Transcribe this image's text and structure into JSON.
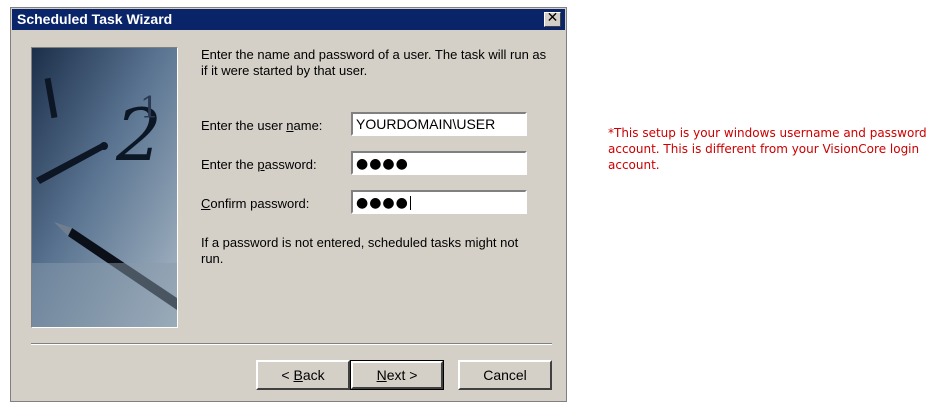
{
  "window": {
    "title": "Scheduled Task Wizard",
    "close_glyph": "✕"
  },
  "intro_text": "Enter the name and password of a user.  The task will run as if it were started by that user.",
  "fields": {
    "username": {
      "label_pre": "Enter the user ",
      "label_ul": "n",
      "label_post": "ame:",
      "value": "YOURDOMAIN\\USER"
    },
    "password": {
      "label_pre": "Enter the ",
      "label_ul": "p",
      "label_post": "assword:",
      "value": "●●●●"
    },
    "confirm": {
      "label_pre": "",
      "label_ul": "C",
      "label_post": "onfirm password:",
      "value": "●●●●"
    }
  },
  "warning_text": "If a password is not entered, scheduled tasks might not run.",
  "buttons": {
    "back": {
      "pre": "< ",
      "ul": "B",
      "post": "ack"
    },
    "next": {
      "pre": "",
      "ul": "N",
      "post": "ext >"
    },
    "cancel": {
      "label": "Cancel"
    }
  },
  "side_note": "*This setup is your windows username and password account. This is different from your VisionCore login account.",
  "colors": {
    "titlebar": "#0a246a",
    "dialog": "#d4d0c8",
    "note": "#cc0000"
  },
  "icons": {
    "close": "close-icon",
    "wizard_art": "clock-and-pen-illustration"
  }
}
